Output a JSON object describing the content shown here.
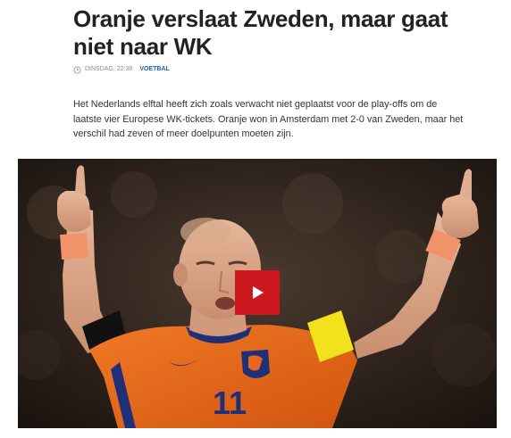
{
  "article": {
    "title": "Oranje verslaat Zweden, maar gaat niet naar WK",
    "meta": {
      "date_label": "DINSDAG, 22:38",
      "category": "VOETBAL"
    },
    "lead": "Het Nederlands elftal heeft zich zoals verwacht niet geplaatst voor de play-offs om de laatste vier Europese WK-tickets. Oranje won in Amsterdam met 2-0 van Zweden, maar het verschil had zeven of meer doelpunten moeten zijn.",
    "video": {
      "jersey_number": "11",
      "colors": {
        "jersey": "#e8661c",
        "captain_band": "#f2e21c",
        "play_button": "#cc181e"
      },
      "icons": [
        "play-icon",
        "knvb-lion-crest",
        "clock-icon"
      ]
    }
  }
}
